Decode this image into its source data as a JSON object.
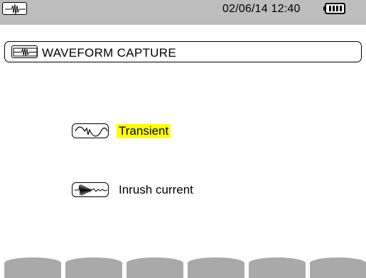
{
  "status_bar": {
    "mode_icon": "waveform-mode-icon",
    "datetime": "02/06/14 12:40",
    "battery_icon": "battery-full-icon",
    "background": "#bdbdbd"
  },
  "header": {
    "icon": "waveform-capture-icon",
    "title": "WAVEFORM CAPTURE"
  },
  "options": [
    {
      "icon": "transient-icon",
      "label": "Transient",
      "selected": true,
      "highlight": "#ffff00"
    },
    {
      "icon": "inrush-current-icon",
      "label": "Inrush current",
      "selected": false
    }
  ],
  "softkeys": [
    {
      "label": ""
    },
    {
      "label": ""
    },
    {
      "label": ""
    },
    {
      "label": ""
    },
    {
      "label": ""
    },
    {
      "label": ""
    }
  ]
}
